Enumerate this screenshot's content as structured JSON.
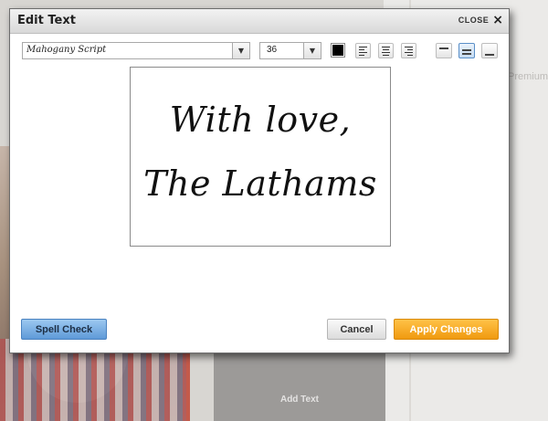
{
  "background": {
    "premium_label": "Premium",
    "add_text_label": "Add Text"
  },
  "dialog": {
    "title": "Edit Text",
    "close_label": "CLOSE",
    "close_icon": "×"
  },
  "toolbar": {
    "font_family": "Mahogany Script",
    "font_size": "36",
    "dropdown_arrow": "▼",
    "text_color": "#000000",
    "align_options": [
      "left",
      "center",
      "right"
    ],
    "vertical_align_options": [
      "top",
      "middle",
      "bottom"
    ],
    "vertical_align_selected": "middle"
  },
  "canvas": {
    "lines": [
      "With love,",
      "The Lathams"
    ]
  },
  "footer": {
    "spell_check_label": "Spell Check",
    "cancel_label": "Cancel",
    "apply_label": "Apply Changes"
  },
  "colors": {
    "primary_button": "#5f9ad8",
    "apply_button": "#f09a10"
  }
}
